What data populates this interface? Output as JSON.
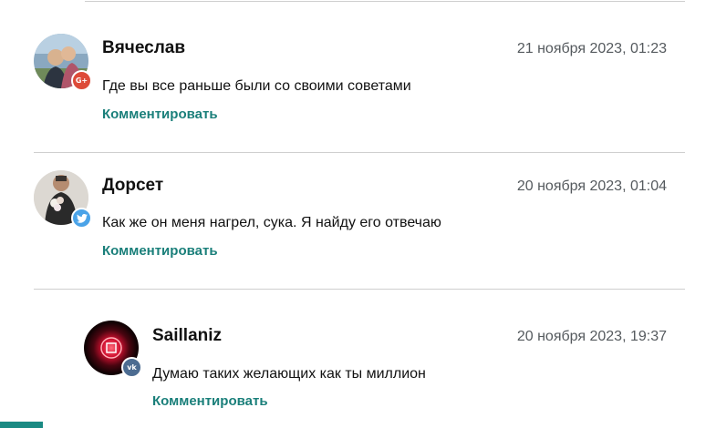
{
  "comments": [
    {
      "author": "Вячеслав",
      "date": "21 ноября 2023, 01:23",
      "text": "Где вы все раньше были со своими советами",
      "reply_label": "Комментировать",
      "social": "google-plus",
      "social_glyph": "G+",
      "social_color": "#dd4b39"
    },
    {
      "author": "Дорсет",
      "date": "20 ноября 2023, 01:04",
      "text": "Как же он меня нагрел, сука. Я найду его отвечаю",
      "reply_label": "Комментировать",
      "social": "twitter",
      "social_glyph": "🐦",
      "social_color": "#4aa3e8"
    },
    {
      "author": "Saillaniz",
      "date": "20 ноября 2023, 19:37",
      "text": "Думаю таких желающих как ты миллион",
      "reply_label": "Комментировать",
      "social": "vk",
      "social_glyph": "vk",
      "social_color": "#4c6c91"
    }
  ],
  "colors": {
    "accent": "#1a7f7a",
    "divider": "#cfcfcf",
    "date_text": "#555a5e"
  }
}
